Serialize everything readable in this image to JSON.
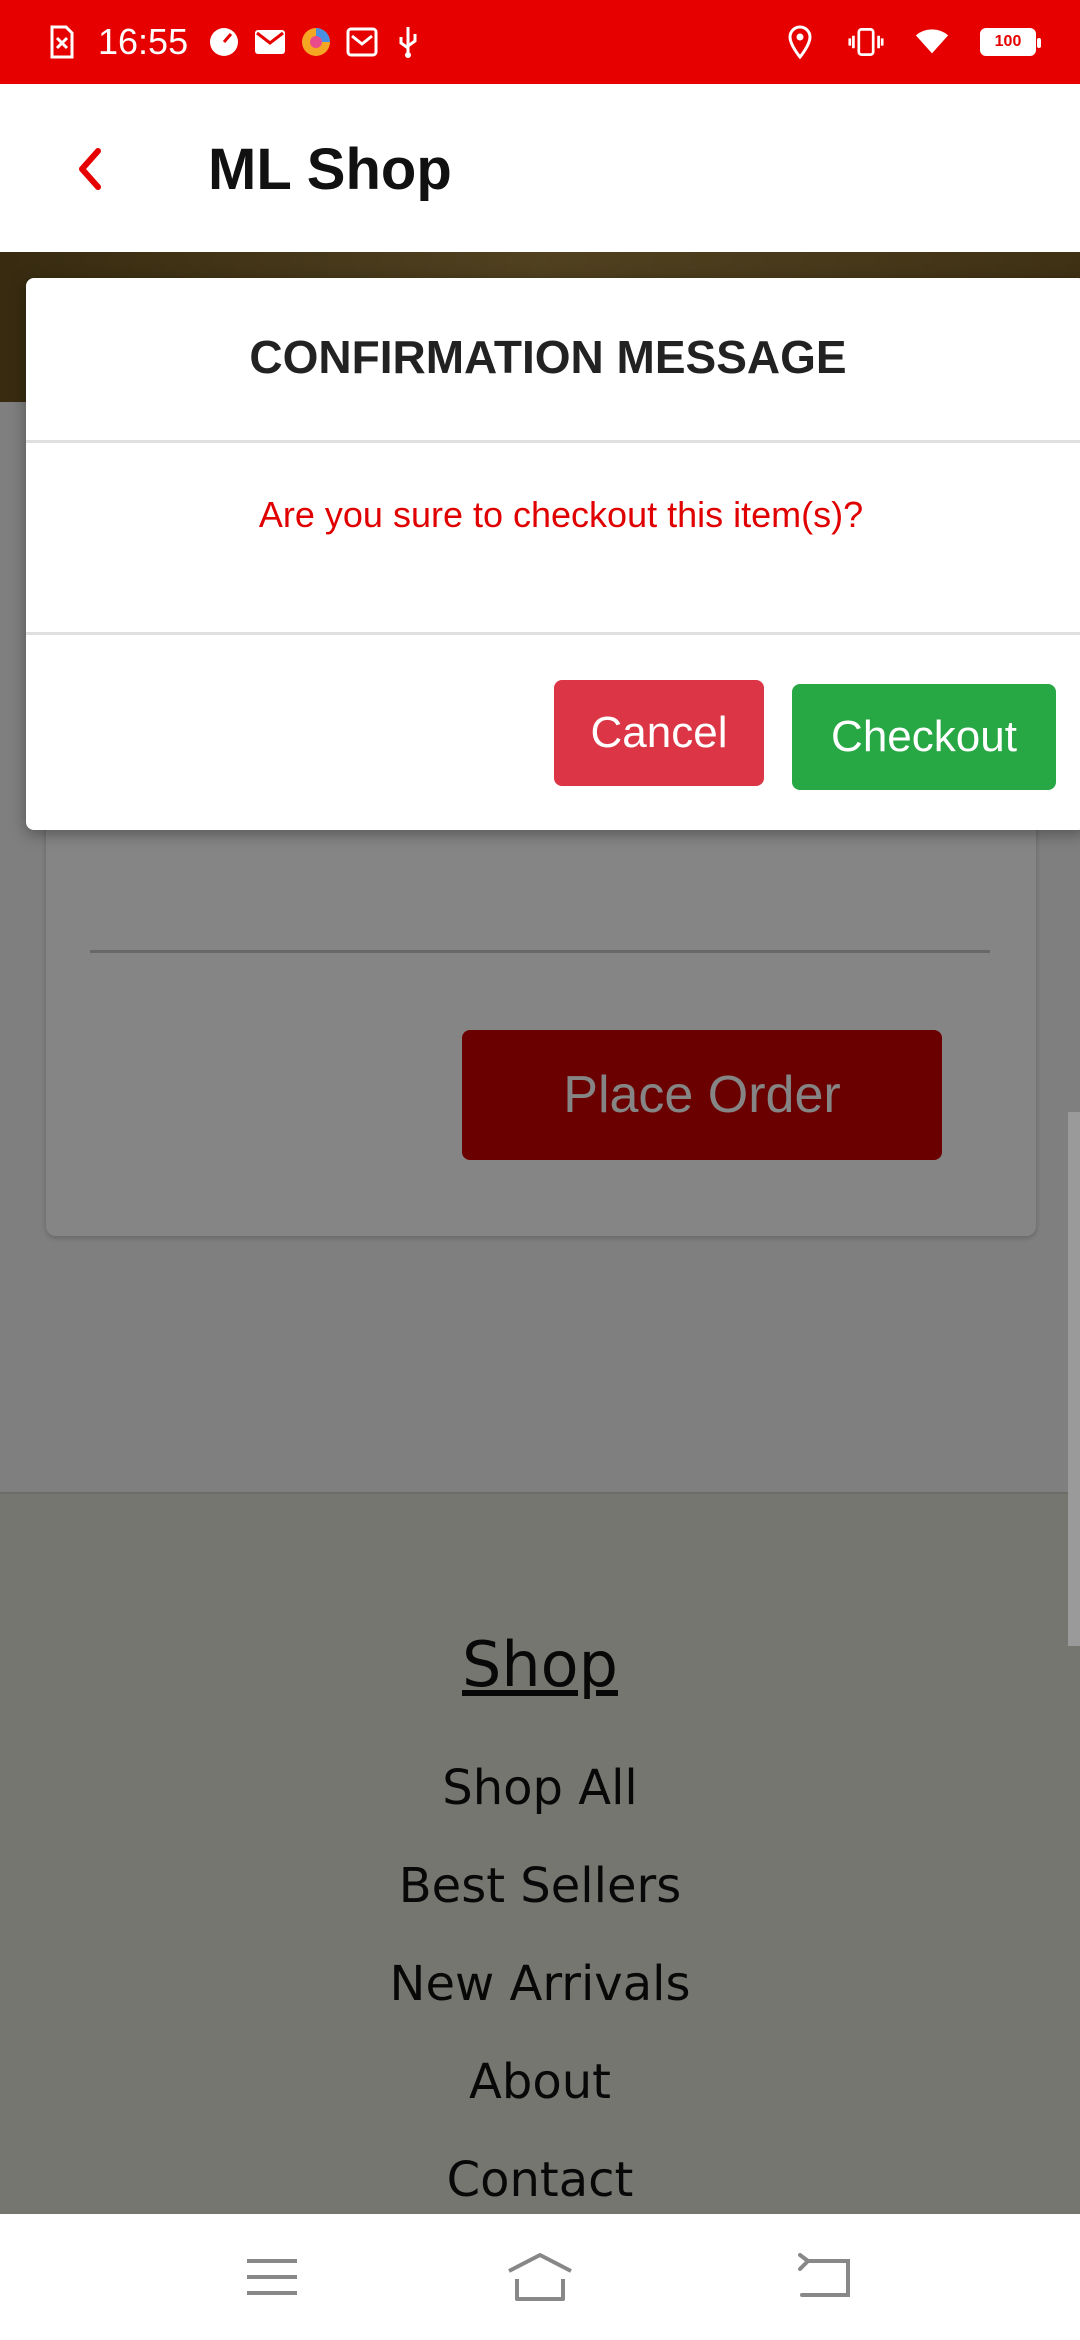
{
  "status_bar": {
    "time": "16:55",
    "left_icons": [
      "sim-error-icon",
      "speedometer-icon",
      "gmail-icon",
      "browser-icon",
      "mail-icon",
      "usb-icon"
    ],
    "right_icons": [
      "location-icon",
      "vibrate-icon",
      "wifi-icon"
    ],
    "battery": "100"
  },
  "app_bar": {
    "title": "ML Shop",
    "back_icon": "chevron-left-icon",
    "accent_color": "#e60000"
  },
  "page": {
    "place_order_label": "Place Order"
  },
  "footer": {
    "heading": "Shop",
    "links": [
      "Shop All",
      "Best Sellers",
      "New Arrivals",
      "About",
      "Contact"
    ]
  },
  "modal": {
    "title": "CONFIRMATION MESSAGE",
    "message": "Are you sure to checkout this item(s)?",
    "cancel_label": "Cancel",
    "checkout_label": "Checkout",
    "colors": {
      "message": "#e00000",
      "cancel": "#dc3545",
      "checkout": "#28a745"
    }
  },
  "nav_bar": {
    "buttons": [
      "menu-icon",
      "home-icon",
      "back-icon"
    ]
  }
}
